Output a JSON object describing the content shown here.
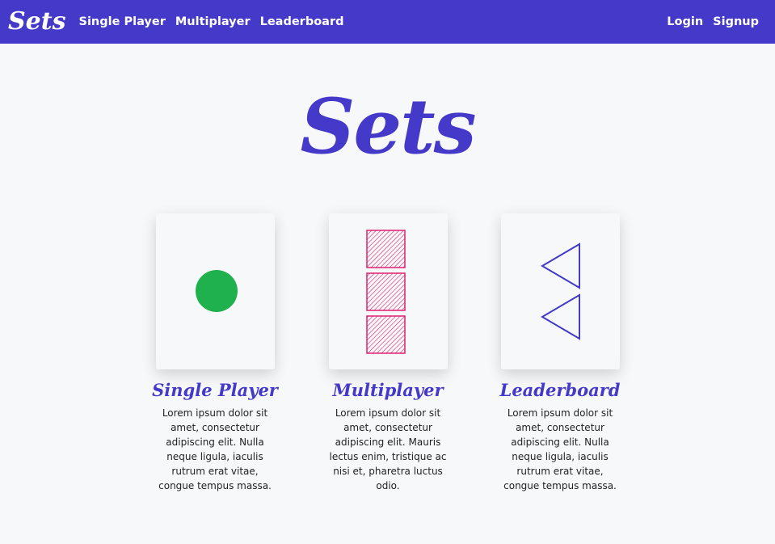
{
  "navbar": {
    "brand": "Sets",
    "links": [
      "Single Player",
      "Multiplayer",
      "Leaderboard"
    ],
    "login_label": "Login",
    "signup_label": "Signup"
  },
  "hero": {
    "title": "Sets"
  },
  "cards": [
    {
      "heading": "Single Player",
      "text": "Lorem ipsum dolor sit amet, consectetur adipiscing elit. Nulla neque ligula, iaculis rutrum erat vitae, congue tempus massa.",
      "symbol": "circle-icon",
      "count": 1,
      "color": "#1fb14e"
    },
    {
      "heading": "Multiplayer",
      "text": "Lorem ipsum dolor sit amet, consectetur adipiscing elit. Mauris lectus enim, tristique ac nisi et, pharetra luctus odio.",
      "symbol": "square-icon",
      "count": 3,
      "color": "#e0206f"
    },
    {
      "heading": "Leaderboard",
      "text": "Lorem ipsum dolor sit amet, consectetur adipiscing elit. Nulla neque ligula, iaculis rutrum erat vitae, congue tempus massa.",
      "symbol": "triangle-icon",
      "count": 2,
      "color": "#4439c8"
    }
  ],
  "colors": {
    "primary": "#4439c8",
    "background": "#f7f8fa"
  }
}
